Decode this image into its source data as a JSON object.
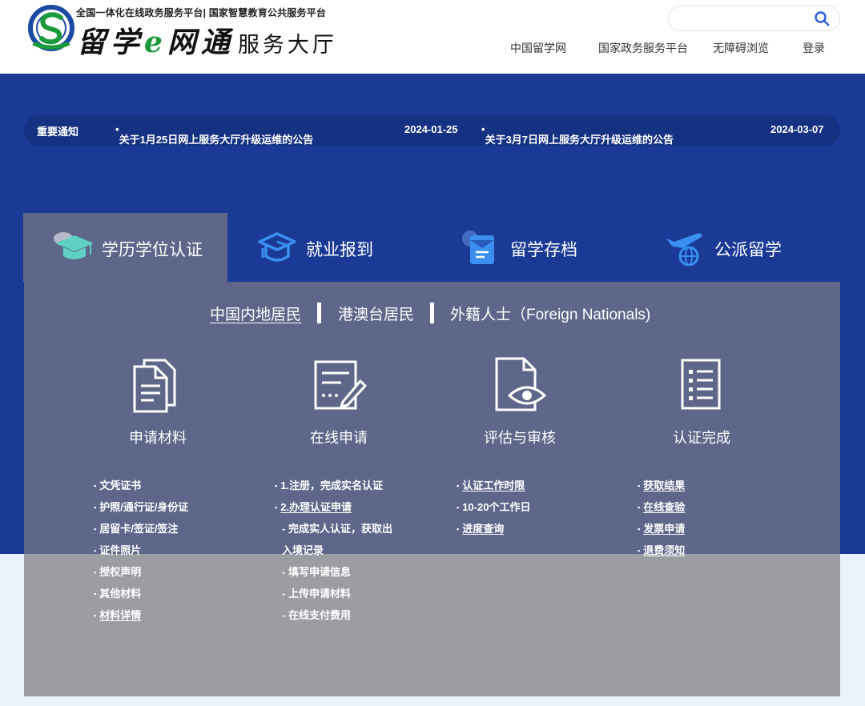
{
  "header": {
    "slogan": "全国一体化在线政务服务平台| 国家智慧教育公共服务平台",
    "title_main_1": "留学",
    "title_main_e": "e",
    "title_main_2": "网通",
    "title_sub": "服务大厅",
    "search_placeholder": "",
    "nav": [
      "中国留学网",
      "国家政务服务平台",
      "无障碍浏览",
      "登录"
    ]
  },
  "notice": {
    "label": "重要通知",
    "items": [
      {
        "title": "关于1月25日网上服务大厅升级运维的公告",
        "date": "2024-01-25"
      },
      {
        "title": "关于3月7日网上服务大厅升级运维的公告",
        "date": "2024-03-07"
      }
    ]
  },
  "tabs": [
    {
      "label": "学历学位认证",
      "icon": "graduation-cap-icon",
      "active": true
    },
    {
      "label": "就业报到",
      "icon": "cap-outline-icon",
      "active": false
    },
    {
      "label": "留学存档",
      "icon": "archive-folder-icon",
      "active": false
    },
    {
      "label": "公派留学",
      "icon": "plane-globe-icon",
      "active": false
    }
  ],
  "subtabs": [
    "中国内地居民",
    "港澳台居民",
    "外籍人士（Foreign Nationals)"
  ],
  "steps": [
    {
      "title": "申请材料",
      "icon": "documents-icon",
      "items": [
        "文凭证书",
        "护照/通行证/身份证",
        "居留卡/签证/签注",
        "证件照片",
        "授权声明",
        "其他材料",
        "材料详情"
      ]
    },
    {
      "title": "在线申请",
      "icon": "form-edit-icon",
      "items": [
        "1.注册，完成实名认证",
        "2.办理认证申请",
        "- 完成实人认证，获取出",
        "入境记录",
        "- 填写申请信息",
        "- 上传申请材料",
        "- 在线支付费用"
      ]
    },
    {
      "title": "评估与审核",
      "icon": "document-eye-icon",
      "items": [
        "认证工作时限",
        "10-20个工作日",
        "进度查询"
      ]
    },
    {
      "title": "认证完成",
      "icon": "checklist-icon",
      "items": [
        "获取结果",
        "在线查验",
        "发票申请",
        "退费须知"
      ]
    }
  ],
  "colors": {
    "header_bg": "#ffffff",
    "banner_blue": "#1a3a96",
    "notice_bar": "#153182",
    "panel": "#5e6789",
    "panel_lower": "#9b9da3",
    "footer_light": "#eaf2fc",
    "logo_green": "#1a9a3a",
    "search_icon": "#2a5bd7"
  }
}
